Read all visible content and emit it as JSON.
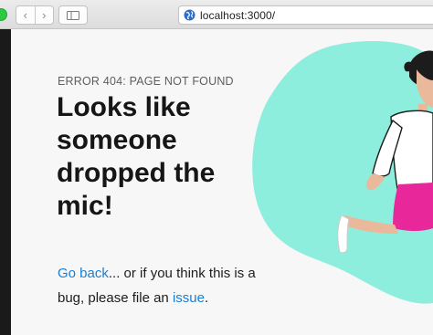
{
  "browser": {
    "url": "localhost:3000/",
    "back_glyph": "‹",
    "forward_glyph": "›",
    "icons": {
      "back": "chevron-left-icon",
      "forward": "chevron-right-icon",
      "sidebar": "sidebar-icon",
      "site": "globe-icon"
    }
  },
  "page": {
    "eyebrow": "ERROR 404: PAGE NOT FOUND",
    "headline": "Looks like someone dropped the mic!",
    "body": {
      "go_back_link": "Go back",
      "middle_text": "... or if you think this is a bug, please file an ",
      "issue_link": "issue",
      "end_text": "."
    }
  },
  "colors": {
    "link": "#1a7fd4",
    "blob": "#8eeedd",
    "skirt": "#e8279a",
    "skin": "#eab89b"
  }
}
